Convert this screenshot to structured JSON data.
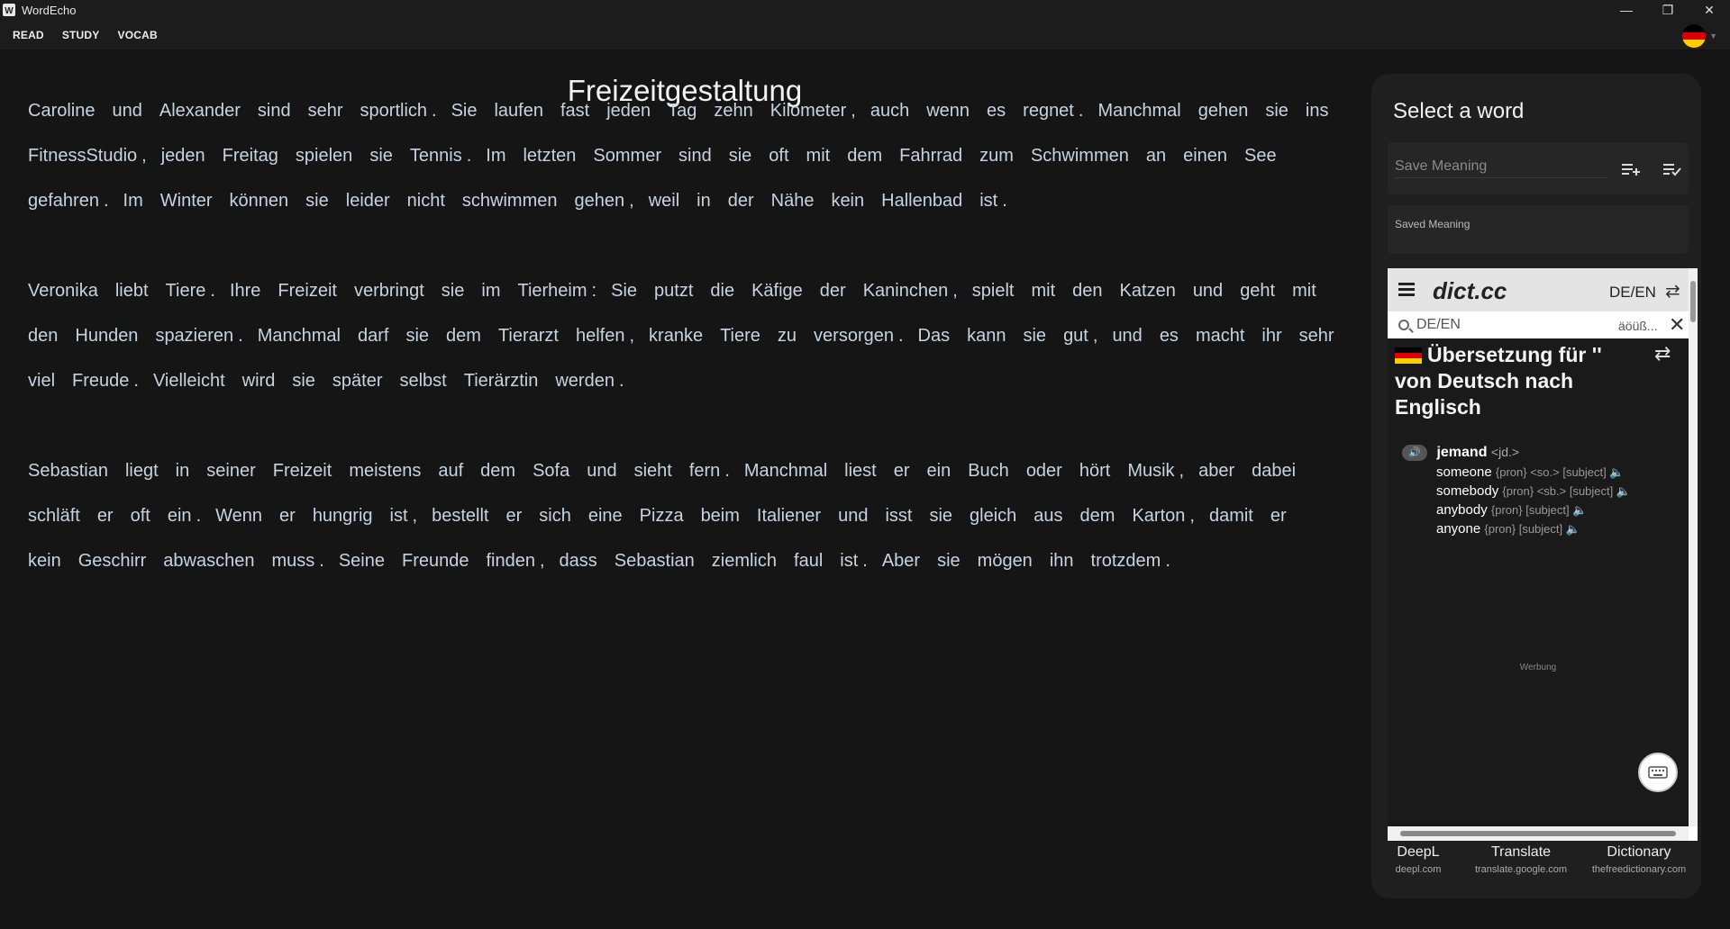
{
  "window": {
    "title": "WordEcho",
    "controls": [
      "—",
      "❐",
      "✕"
    ]
  },
  "menu": {
    "items": [
      "READ",
      "STUDY",
      "VOCAB"
    ],
    "language_flag": "germany-flag"
  },
  "reader": {
    "title": "Freizeitgestaltung",
    "paragraphs": [
      [
        "Caroline",
        "und",
        "Alexander",
        "sind",
        "sehr",
        "sportlich",
        ".",
        "Sie",
        "laufen",
        "fast",
        "jeden",
        "Tag",
        "zehn",
        "Kilometer",
        ",",
        "auch",
        "wenn",
        "es",
        "regnet",
        ".",
        "Manchmal",
        "gehen",
        "sie",
        "ins",
        "FitnessStudio",
        ",",
        "jeden",
        "Freitag",
        "spielen",
        "sie",
        "Tennis",
        ".",
        "Im",
        "letzten",
        "Sommer",
        "sind",
        "sie",
        "oft",
        "mit",
        "dem",
        "Fahrrad",
        "zum",
        "Schwimmen",
        "an",
        "einen",
        "See",
        "gefahren",
        ".",
        "Im",
        "Winter",
        "können",
        "sie",
        "leider",
        "nicht",
        "schwimmen",
        "gehen",
        ",",
        "weil",
        "in",
        "der",
        "Nähe",
        "kein",
        "Hallenbad",
        "ist",
        "."
      ],
      [
        "Veronika",
        "liebt",
        "Tiere",
        ".",
        "Ihre",
        "Freizeit",
        "verbringt",
        "sie",
        "im",
        "Tierheim",
        ":",
        "Sie",
        "putzt",
        "die",
        "Käfige",
        "der",
        "Kaninchen",
        ",",
        "spielt",
        "mit",
        "den",
        "Katzen",
        "und",
        "geht",
        "mit",
        "den",
        "Hunden",
        "spazieren",
        ".",
        "Manchmal",
        "darf",
        "sie",
        "dem",
        "Tierarzt",
        "helfen",
        ",",
        "kranke",
        "Tiere",
        "zu",
        "versorgen",
        ".",
        "Das",
        "kann",
        "sie",
        "gut",
        ",",
        "und",
        "es",
        "macht",
        "ihr",
        "sehr",
        "viel",
        "Freude",
        ".",
        "Vielleicht",
        "wird",
        "sie",
        "später",
        "selbst",
        "Tierärztin",
        "werden",
        "."
      ],
      [
        "Sebastian",
        "liegt",
        "in",
        "seiner",
        "Freizeit",
        "meistens",
        "auf",
        "dem",
        "Sofa",
        "und",
        "sieht",
        "fern",
        ".",
        "Manchmal",
        "liest",
        "er",
        "ein",
        "Buch",
        "oder",
        "hört",
        "Musik",
        ",",
        "aber",
        "dabei",
        "schläft",
        "er",
        "oft",
        "ein",
        ".",
        "Wenn",
        "er",
        "hungrig",
        "ist",
        ",",
        "bestellt",
        "er",
        "sich",
        "eine",
        "Pizza",
        "beim",
        "Italiener",
        "und",
        "isst",
        "sie",
        "gleich",
        "aus",
        "dem",
        "Karton",
        ",",
        "damit",
        "er",
        "kein",
        "Geschirr",
        "abwaschen",
        "muss",
        ".",
        "Seine",
        "Freunde",
        "finden",
        ",",
        "dass",
        "Sebastian",
        "ziemlich",
        "faul",
        "ist",
        ".",
        "Aber",
        "sie",
        "mögen",
        "ihn",
        "trotzdem",
        "."
      ]
    ]
  },
  "panel": {
    "title": "Select a word",
    "save_placeholder": "Save Meaning",
    "saved_label": "Saved Meaning",
    "dict": {
      "logo": "dict.cc",
      "lang": "DE/EN",
      "search_placeholder": "DE/EN",
      "special_chars": "äöüß...",
      "heading": "Übersetzung für '' von Deutsch nach Englisch",
      "headword": "jemand",
      "headword_tag": "<jd.>",
      "translations": [
        {
          "word": "someone",
          "meta": "{pron} <so.> [subject]"
        },
        {
          "word": "somebody",
          "meta": "{pron} <sb.> [subject]"
        },
        {
          "word": "anybody",
          "meta": "{pron} [subject]"
        },
        {
          "word": "anyone",
          "meta": "{pron} [subject]"
        }
      ],
      "ad_label": "Werbung"
    },
    "links": [
      {
        "name": "DeepL",
        "url": "deepl.com"
      },
      {
        "name": "Translate",
        "url": "translate.google.com"
      },
      {
        "name": "Dictionary",
        "url": "thefreedictionary.com"
      }
    ]
  },
  "colors": {
    "background": "#151515",
    "text": "#c8d3e0",
    "panel": "#1f1f1f"
  }
}
